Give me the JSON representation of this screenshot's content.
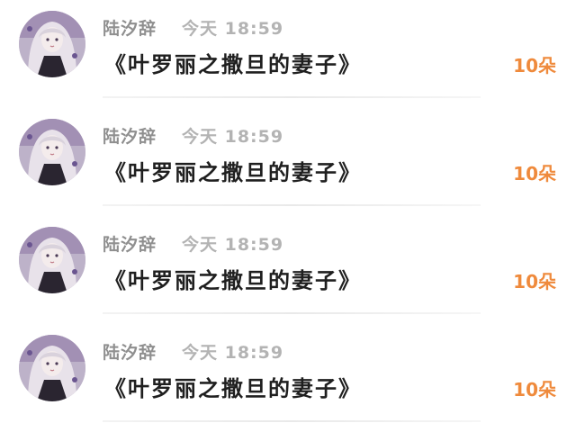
{
  "feed": {
    "items": [
      {
        "name": "陆汐辞",
        "time": "今天 18:59",
        "message": "《叶罗丽之撒旦的妻子》",
        "gift": "10朵"
      },
      {
        "name": "陆汐辞",
        "time": "今天 18:59",
        "message": "《叶罗丽之撒旦的妻子》",
        "gift": "10朵"
      },
      {
        "name": "陆汐辞",
        "time": "今天 18:59",
        "message": "《叶罗丽之撒旦的妻子》",
        "gift": "10朵"
      },
      {
        "name": "陆汐辞",
        "time": "今天 18:59",
        "message": "《叶罗丽之撒旦的妻子》",
        "gift": "10朵"
      }
    ]
  },
  "colors": {
    "name": "#8f8f8f",
    "time": "#b3b3b3",
    "message": "#1f1f1f",
    "gift": "#ef8a3c",
    "divider": "#ececec"
  },
  "icons": {
    "avatar": "user-avatar-anime-girl"
  }
}
